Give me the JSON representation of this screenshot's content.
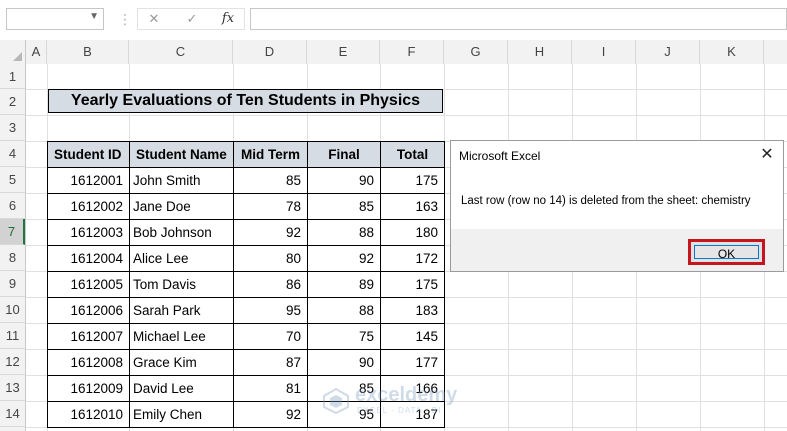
{
  "formula_bar": {
    "name_box": "",
    "cancel_icon": "✕",
    "enter_icon": "✓",
    "function_icon": "fx",
    "formula": ""
  },
  "columns": [
    "A",
    "B",
    "C",
    "D",
    "E",
    "F",
    "G",
    "H",
    "I",
    "J",
    "K"
  ],
  "rows": [
    "1",
    "2",
    "3",
    "4",
    "5",
    "6",
    "7",
    "8",
    "9",
    "10",
    "11",
    "12",
    "13",
    "14"
  ],
  "selected_row": "7",
  "sheet": {
    "title": "Yearly Evaluations of Ten Students in Physics",
    "headers": [
      "Student ID",
      "Student Name",
      "Mid Term",
      "Final",
      "Total"
    ],
    "records": [
      [
        "1612001",
        "John Smith",
        "85",
        "90",
        "175"
      ],
      [
        "1612002",
        "Jane Doe",
        "78",
        "85",
        "163"
      ],
      [
        "1612003",
        "Bob Johnson",
        "92",
        "88",
        "180"
      ],
      [
        "1612004",
        "Alice Lee",
        "80",
        "92",
        "172"
      ],
      [
        "1612005",
        "Tom Davis",
        "86",
        "89",
        "175"
      ],
      [
        "1612006",
        "Sarah Park",
        "95",
        "88",
        "183"
      ],
      [
        "1612007",
        "Michael Lee",
        "70",
        "75",
        "145"
      ],
      [
        "1612008",
        "Grace Kim",
        "87",
        "90",
        "177"
      ],
      [
        "1612009",
        "David Lee",
        "81",
        "85",
        "166"
      ],
      [
        "1612010",
        "Emily Chen",
        "92",
        "95",
        "187"
      ]
    ]
  },
  "dialog": {
    "title": "Microsoft Excel",
    "message": "Last row (row no 14) is deleted from the sheet: chemistry",
    "ok_label": "OK",
    "close_icon": "✕"
  },
  "watermark": {
    "name": "exceldemy",
    "tagline": "EXCEL · DATA · BI"
  },
  "colors": {
    "header_fill": "#d6dce4",
    "highlight_red": "#c4161c",
    "selected_row_green": "#217346"
  }
}
